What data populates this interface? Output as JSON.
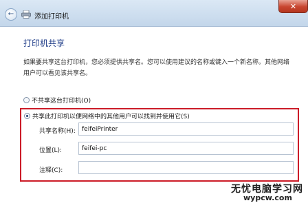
{
  "window": {
    "title": "添加打印机",
    "back_icon": "back-arrow-icon",
    "printer_icon": "printer-icon",
    "close_label": "✕"
  },
  "main": {
    "heading": "打印机共享",
    "description": "如果要共享这台打印机，您必须提供共享名。您可以使用建议的名称或键入一个新名称。其他网络用户可以看见该共享名。",
    "options": [
      {
        "label": "不共享这台打印机(O)",
        "selected": false
      },
      {
        "label": "共享此打印机以便网络中的其他用户可以找到并使用它(S)",
        "selected": true
      }
    ],
    "fields": {
      "share_name": {
        "label": "共享名称(H):",
        "value": "feifeiPrinter"
      },
      "location": {
        "label": "位置(L):",
        "value": "feifei-pc"
      },
      "comment": {
        "label": "注释(C):",
        "value": ""
      }
    },
    "highlight_color": "#cc1c28"
  },
  "watermark": {
    "line1": "无忧电脑学习网",
    "line2": "wypcw.com"
  }
}
